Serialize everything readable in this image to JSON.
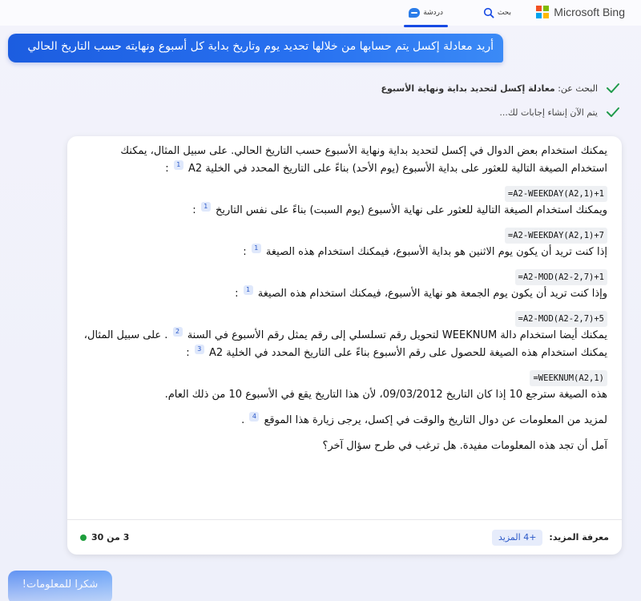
{
  "header": {
    "brand": "Microsoft Bing",
    "tabs": [
      {
        "label": "بحث",
        "icon": "search-icon"
      },
      {
        "label": "دردشة",
        "icon": "chat-icon",
        "active": true
      }
    ]
  },
  "user_query": "أريد معادلة إكسل يتم حسابها من خلالها تحديد يوم وتاريخ بداية كل أسبوع ونهايته حسب التاريخ الحالي",
  "status": {
    "search_prefix": "البحث عن:",
    "search_term": "معادلة إكسل لتحديد بداية ونهاية الأسبوع",
    "generating": "يتم الآن إنشاء إجابات لك..."
  },
  "answer": {
    "p1a": "يمكنك استخدام بعض الدوال في إكسل لتحديد بداية ونهاية الأسبوع حسب التاريخ الحالي. على سبيل المثال، يمكنك استخدام الصيغة التالية للعثور على بداية الأسبوع (يوم الأحد) بناءً على التاريخ المحدد في الخلية A2",
    "p1_cite": "1",
    "p1_end": ":",
    "code1": "=A2-WEEKDAY(A2,1)+1",
    "p2a": "ويمكنك استخدام الصيغة التالية للعثور على نهاية الأسبوع (يوم السبت) بناءً على نفس التاريخ",
    "p2_cite": "1",
    "p2_end": ":",
    "code2": "=A2-WEEKDAY(A2,1)+7",
    "p3a": "إذا كنت تريد أن يكون يوم الاثنين هو بداية الأسبوع، فيمكنك استخدام هذه الصيغة",
    "p3_cite": "1",
    "p3_end": ":",
    "code3": "=A2-MOD(A2-2,7)+1",
    "p4a": "وإذا كنت تريد أن يكون يوم الجمعة هو نهاية الأسبوع، فيمكنك استخدام هذه الصيغة",
    "p4_cite": "1",
    "p4_end": ":",
    "code4": "=A2-MOD(A2-2,7)+5",
    "p5a": "يمكنك أيضا استخدام دالة WEEKNUM لتحويل رقم تسلسلي إلى رقم يمثل رقم الأسبوع في السنة",
    "p5_cite1": "2",
    "p5b": ". على سبيل المثال، يمكنك استخدام هذه الصيغة للحصول على رقم الأسبوع بناءً على التاريخ المحدد في الخلية A2",
    "p5_cite2": "3",
    "p5_end": ":",
    "code5": "=WEEKNUM(A2,1)",
    "p6": "هذه الصيغة سترجع 10 إذا كان التاريخ 09/03/2012، لأن هذا التاريخ يقع في الأسبوع 10 من ذلك العام.",
    "p7a": "لمزيد من المعلومات عن دوال التاريخ والوقت في إكسل، يرجى زيارة هذا الموقع",
    "p7_cite": "4",
    "p7_end": ".",
    "p8": "آمل أن تجد هذه المعلومات مفيدة. هل ترغب في طرح سؤال آخر؟"
  },
  "footer": {
    "learn_more_label": "معرفة المزيد:",
    "more_pill": "+4 المزيد",
    "counter": "3 من 30"
  },
  "suggestion": "شكرا للمعلومات!",
  "colors": {
    "accent": "#174ae4",
    "counter_dot": "#1e9e3c"
  }
}
